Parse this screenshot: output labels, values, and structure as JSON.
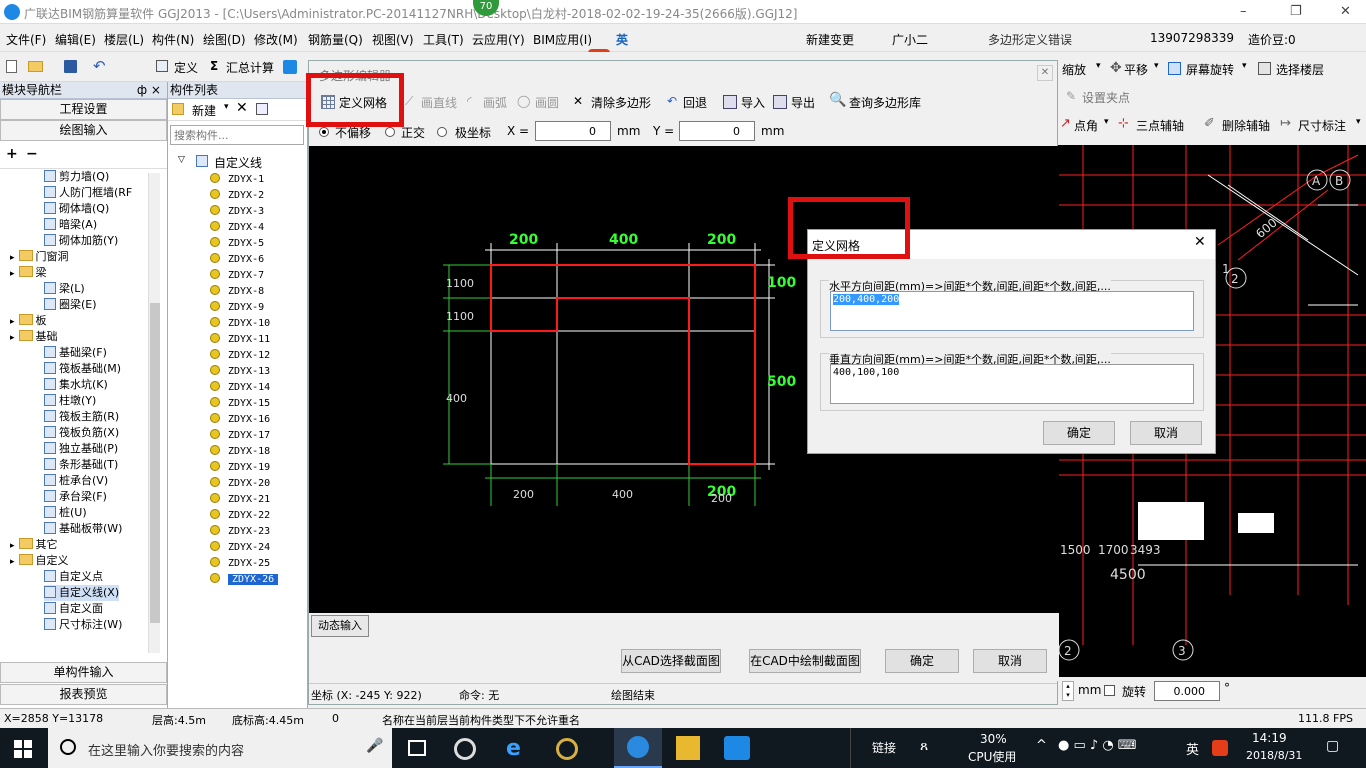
{
  "titlebar": {
    "title": "广联达BIM钢筋算量软件 GGJ2013 - [C:\\Users\\Administrator.PC-20141127NRH\\Desktop\\白龙村-2018-02-02-19-24-35(2666版).GGJ12]",
    "badge": "70",
    "minimize": "–",
    "restore": "❐",
    "close": "✕"
  },
  "menubar": {
    "items": [
      "文件(F)",
      "编辑(E)",
      "楼层(L)",
      "构件(N)",
      "绘图(D)",
      "修改(M)",
      "钢筋量(Q)",
      "视图(V)",
      "工具(T)",
      "云应用(Y)",
      "BIM应用(I)"
    ],
    "ime": "英",
    "new_change": "新建变更",
    "assistant": "广小二",
    "error_msg": "多边形定义错误",
    "phone": "13907298339",
    "price": "造价豆:0"
  },
  "toolbar": {
    "define": "定义",
    "summary": "汇总计算",
    "zoom": "缩放",
    "pan": "平移",
    "rotate": "屏幕旋转",
    "select_floor": "选择楼层",
    "set_node": "设置夹点",
    "point_angle": "点角",
    "three_point_aux": "三点辅轴",
    "delete_aux": "删除辅轴",
    "dim": "尺寸标注"
  },
  "nav": {
    "title": "模块导航栏",
    "pin": "ф ×",
    "project_settings": "工程设置",
    "drawing_input": "绘图输入",
    "tree": [
      {
        "label": "剪力墙(Q)",
        "type": "leaf"
      },
      {
        "label": "人防门框墙(RF",
        "type": "leaf"
      },
      {
        "label": "砌体墙(Q)",
        "type": "leaf"
      },
      {
        "label": "暗梁(A)",
        "type": "leaf"
      },
      {
        "label": "砌体加筋(Y)",
        "type": "leaf"
      },
      {
        "label": "门窗洞",
        "type": "folder"
      },
      {
        "label": "梁",
        "type": "folder"
      },
      {
        "label": "梁(L)",
        "type": "leaf"
      },
      {
        "label": "圈梁(E)",
        "type": "leaf"
      },
      {
        "label": "板",
        "type": "folder"
      },
      {
        "label": "基础",
        "type": "folder"
      },
      {
        "label": "基础梁(F)",
        "type": "leaf"
      },
      {
        "label": "筏板基础(M)",
        "type": "leaf"
      },
      {
        "label": "集水坑(K)",
        "type": "leaf"
      },
      {
        "label": "柱墩(Y)",
        "type": "leaf"
      },
      {
        "label": "筏板主筋(R)",
        "type": "leaf"
      },
      {
        "label": "筏板负筋(X)",
        "type": "leaf"
      },
      {
        "label": "独立基础(P)",
        "type": "leaf"
      },
      {
        "label": "条形基础(T)",
        "type": "leaf"
      },
      {
        "label": "桩承台(V)",
        "type": "leaf"
      },
      {
        "label": "承台梁(F)",
        "type": "leaf"
      },
      {
        "label": "桩(U)",
        "type": "leaf"
      },
      {
        "label": "基础板带(W)",
        "type": "leaf"
      },
      {
        "label": "其它",
        "type": "folder"
      },
      {
        "label": "自定义",
        "type": "folder"
      },
      {
        "label": "自定义点",
        "type": "leaf"
      },
      {
        "label": "自定义线(X)",
        "type": "leaf"
      },
      {
        "label": "自定义面",
        "type": "leaf"
      },
      {
        "label": "尺寸标注(W)",
        "type": "leaf"
      }
    ],
    "single_input": "单构件输入",
    "report_preview": "报表预览"
  },
  "complist": {
    "title": "构件列表",
    "new": "新建",
    "search_placeholder": "搜索构件...",
    "root": "自定义线",
    "items": [
      "ZDYX-1",
      "ZDYX-2",
      "ZDYX-3",
      "ZDYX-4",
      "ZDYX-5",
      "ZDYX-6",
      "ZDYX-7",
      "ZDYX-8",
      "ZDYX-9",
      "ZDYX-10",
      "ZDYX-11",
      "ZDYX-12",
      "ZDYX-13",
      "ZDYX-14",
      "ZDYX-15",
      "ZDYX-16",
      "ZDYX-17",
      "ZDYX-18",
      "ZDYX-19",
      "ZDYX-20",
      "ZDYX-21",
      "ZDYX-22",
      "ZDYX-23",
      "ZDYX-24",
      "ZDYX-25",
      "ZDYX-26"
    ],
    "selected": "ZDYX-26"
  },
  "editor": {
    "title": "多边形编辑器",
    "tools": {
      "define_grid": "定义网格",
      "draw_line": "画直线",
      "draw_arc": "画弧",
      "draw_circle": "画圆",
      "clear_polygon": "清除多边形",
      "undo": "回退",
      "import": "导入",
      "export": "导出",
      "query_lib": "查询多边形库"
    },
    "options": {
      "no_offset": "不偏移",
      "ortho": "正交",
      "polar": "极坐标",
      "x_label": "X =",
      "x_value": "0",
      "y_label": "Y =",
      "y_value": "0",
      "unit": "mm"
    },
    "dims": {
      "top": [
        "200",
        "400",
        "200"
      ],
      "right": [
        "100",
        "500"
      ],
      "left": [
        "100",
        "100",
        "400"
      ],
      "left_overlap": [
        "1100",
        "1100"
      ],
      "bottom": [
        "200",
        "400",
        "200"
      ],
      "bottom_extra": "200"
    },
    "dynamic_input": "动态输入",
    "select_from_cad": "从CAD选择截面图",
    "draw_in_cad": "在CAD中绘制截面图",
    "ok": "确定",
    "cancel": "取消",
    "coords": "坐标 (X: -245 Y: 922)",
    "command": "命令: 无",
    "drawing_end": "绘图结束"
  },
  "dialog": {
    "title": "定义网格",
    "horiz_label": "水平方向间距(mm)=>间距*个数,间距,间距*个数,间距,...",
    "horiz_value": "200,400,200",
    "vert_label": "垂直方向间距(mm)=>间距*个数,间距,间距*个数,间距,...",
    "vert_value": "400,100,100",
    "ok": "确定",
    "cancel": "取消"
  },
  "cad_right": {
    "labels": [
      "A",
      "B",
      "1",
      "2",
      "600",
      "1500",
      "1700",
      "3493",
      "4500",
      "2",
      "3"
    ],
    "unit": "mm",
    "rotate_label": "旋转",
    "rotate_value": "0.000",
    "degree": "°"
  },
  "statusbar": {
    "xy": "X=2858 Y=13178",
    "floor_height": "层高:4.5m",
    "bottom_height": "底标高:4.45m",
    "zero": "0",
    "message": "名称在当前层当前构件类型下不允许重名",
    "fps": "111.8 FPS"
  },
  "taskbar": {
    "search": "在这里输入你要搜索的内容",
    "link": "链接",
    "cpu_pct": "30%",
    "cpu_label": "CPU使用",
    "ime": "英",
    "time": "14:19",
    "date": "2018/8/31"
  }
}
